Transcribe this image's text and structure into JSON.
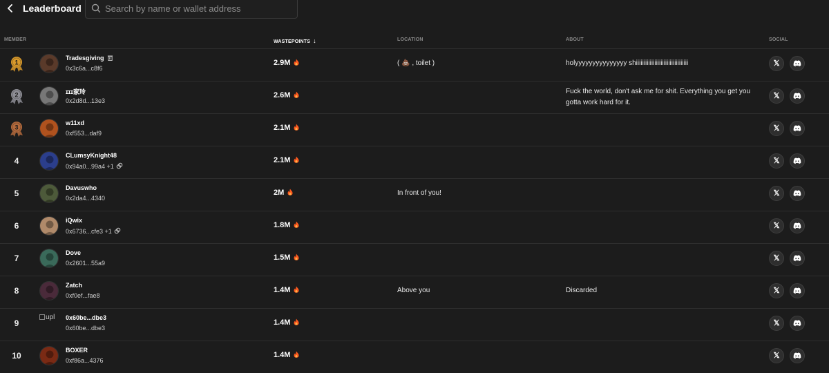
{
  "header": {
    "title": "Leaderboard",
    "search_placeholder": "Search by name or wallet address"
  },
  "columns": {
    "member": "MEMBER",
    "wastepoints": "WASTEPOINTS",
    "location": "LOCATION",
    "about": "ABOUT",
    "social": "SOCIAL"
  },
  "colors": {
    "accent_flame": "#ff5a1f",
    "gold": "#d99a2b",
    "silver": "#8e8e96",
    "bronze": "#b46a3c"
  },
  "rows": [
    {
      "rank": "1",
      "name": "Tradesgiving",
      "address": "0x3c6a...c8f6",
      "points": "2.9M",
      "location": "( 💩 , toilet )",
      "about": "holyyyyyyyyyyyyyyy shiiiiiiiiiiiiiiiiiiiiiiiiiiiiiiiiii",
      "avatar": "#5a3a2a"
    },
    {
      "rank": "2",
      "name": "ɪɪɪ家玲",
      "address": "0x2d8d...13e3",
      "points": "2.6M",
      "location": "",
      "about": "Fuck the world, don't ask me for shit. Everything you get you gotta work hard for it.",
      "avatar": "#777777"
    },
    {
      "rank": "3",
      "name": "w11xd",
      "address": "0xf553...daf9",
      "points": "2.1M",
      "location": "",
      "about": "",
      "avatar": "#b0521e"
    },
    {
      "rank": "4",
      "name": "CLumsyKnight48",
      "address": "0x94a0...99a4 +1",
      "points": "2.1M",
      "location": "",
      "about": "",
      "avatar": "#2b3e8c"
    },
    {
      "rank": "5",
      "name": "Davuswho",
      "address": "0x2da4...4340",
      "points": "2M",
      "location": "In front of you!",
      "about": "",
      "avatar": "#4d5a3a"
    },
    {
      "rank": "6",
      "name": "iQwix",
      "address": "0x6736...cfe3 +1",
      "points": "1.8M",
      "location": "",
      "about": "",
      "avatar": "#b08a6a"
    },
    {
      "rank": "7",
      "name": "Dove",
      "address": "0x2601...55a9",
      "points": "1.5M",
      "location": "",
      "about": "",
      "avatar": "#3a6a5a"
    },
    {
      "rank": "8",
      "name": "Zatch",
      "address": "0xf0ef...fae8",
      "points": "1.4M",
      "location": "Above you",
      "about": "Discarded",
      "avatar": "#4a2a3a"
    },
    {
      "rank": "9",
      "name": "0x60be...dbe3",
      "address": "0x60be...dbe3",
      "points": "1.4M",
      "location": "",
      "about": "",
      "avatar_alt": "upl"
    },
    {
      "rank": "10",
      "name": "BOXER",
      "address": "0xf86a...4376",
      "points": "1.4M",
      "location": "",
      "about": "",
      "avatar": "#7a2a14"
    }
  ]
}
